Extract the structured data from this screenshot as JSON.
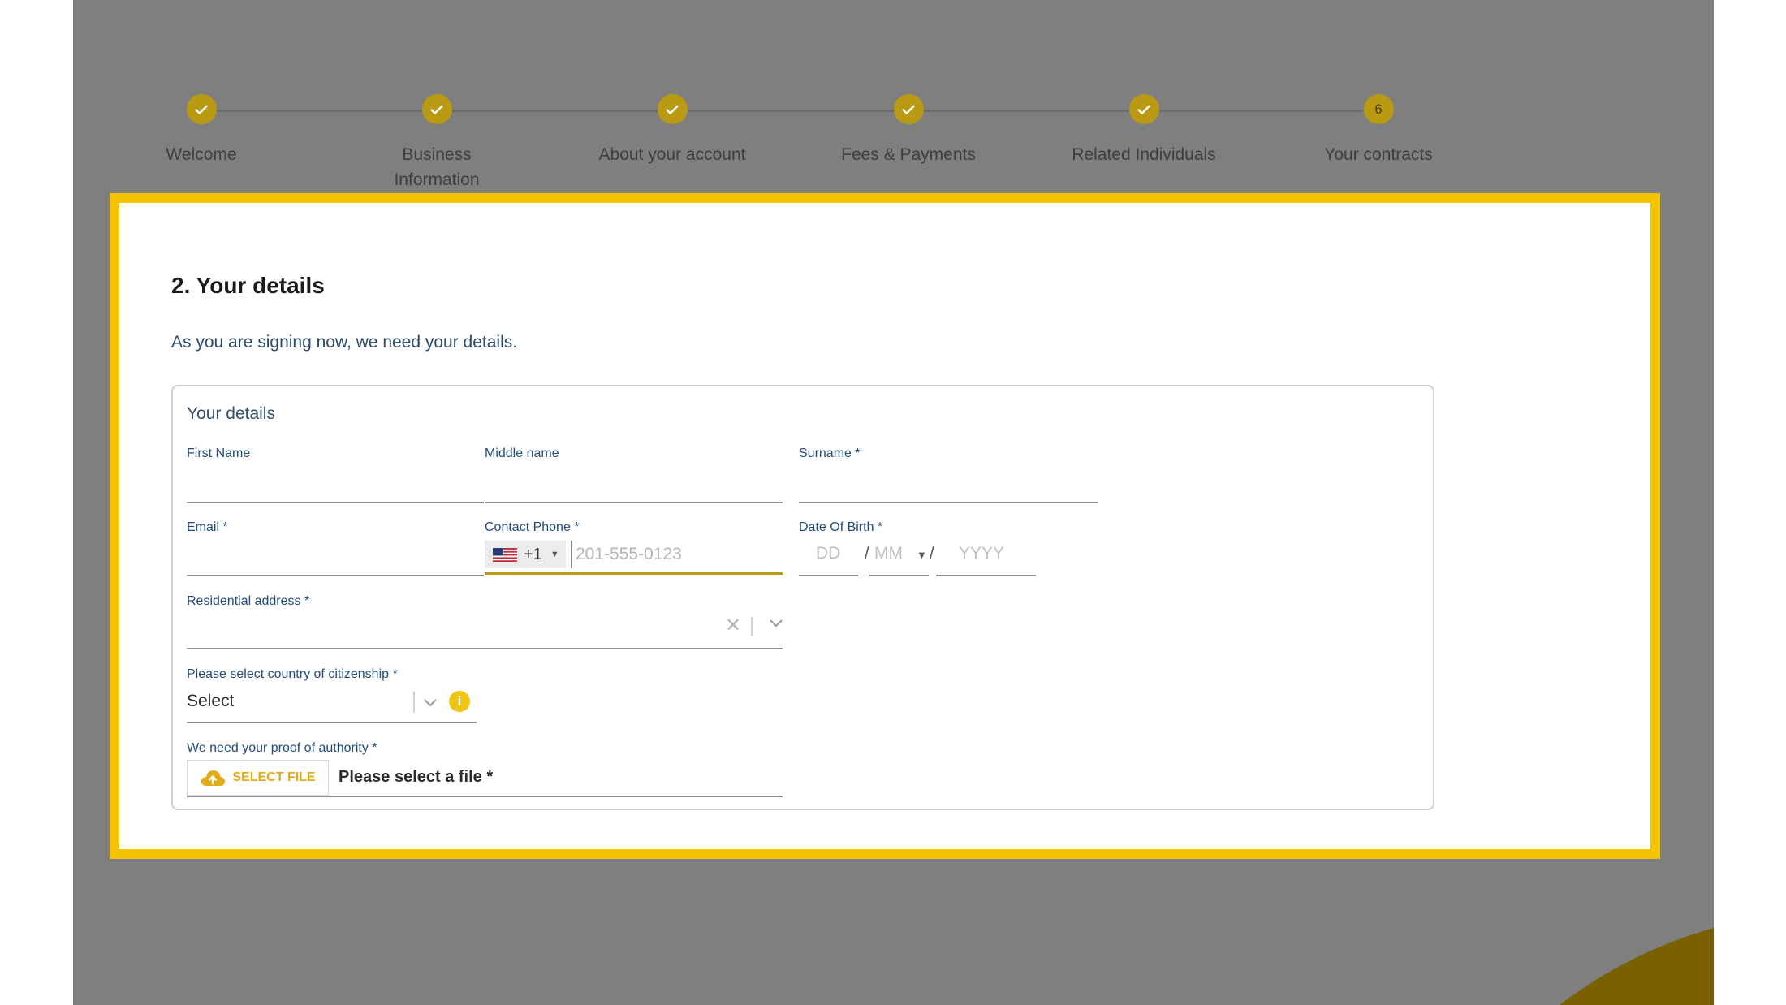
{
  "stepper": {
    "steps": [
      {
        "label": "Welcome",
        "state": "done"
      },
      {
        "label": "Business Information",
        "state": "done"
      },
      {
        "label": "About your account",
        "state": "done"
      },
      {
        "label": "Fees & Payments",
        "state": "done"
      },
      {
        "label": "Related Individuals",
        "state": "done"
      },
      {
        "label": "Your contracts",
        "state": "current",
        "number": "6"
      }
    ]
  },
  "section": {
    "title": "2. Your details",
    "subtitle": "As you are signing now, we need your details."
  },
  "details_box": {
    "title": "Your details",
    "first_name": {
      "label": "First Name",
      "value": ""
    },
    "middle_name": {
      "label": "Middle name",
      "value": ""
    },
    "surname": {
      "label": "Surname *",
      "value": ""
    },
    "email": {
      "label": "Email *",
      "value": ""
    },
    "contact_phone": {
      "label": "Contact Phone *",
      "country_code": "+1",
      "flag": "us-flag-icon",
      "placeholder": "201-555-0123"
    },
    "date_of_birth": {
      "label": "Date Of Birth *",
      "day_placeholder": "DD",
      "month_placeholder": "MM",
      "year_placeholder": "YYYY",
      "separator": "/"
    },
    "residential_address": {
      "label": "Residential address *",
      "value": ""
    },
    "citizenship": {
      "label": "Please select country of citizenship *",
      "value": "Select"
    },
    "proof_of_authority": {
      "label": "We need your proof of authority *",
      "button_label": "SELECT FILE",
      "status": "Please select a file *"
    }
  },
  "colors": {
    "highlight_border": "#f5c400",
    "step_accent": "#b99a12",
    "backdrop": "#7f7f7f",
    "label_blue": "#1f4a7a",
    "info_icon": "#f0c414"
  },
  "icons": {
    "step_done": "check-icon",
    "address_clear": "close-icon",
    "dropdown": "chevron-down-icon",
    "info": "info-icon",
    "upload": "cloud-upload-icon"
  }
}
